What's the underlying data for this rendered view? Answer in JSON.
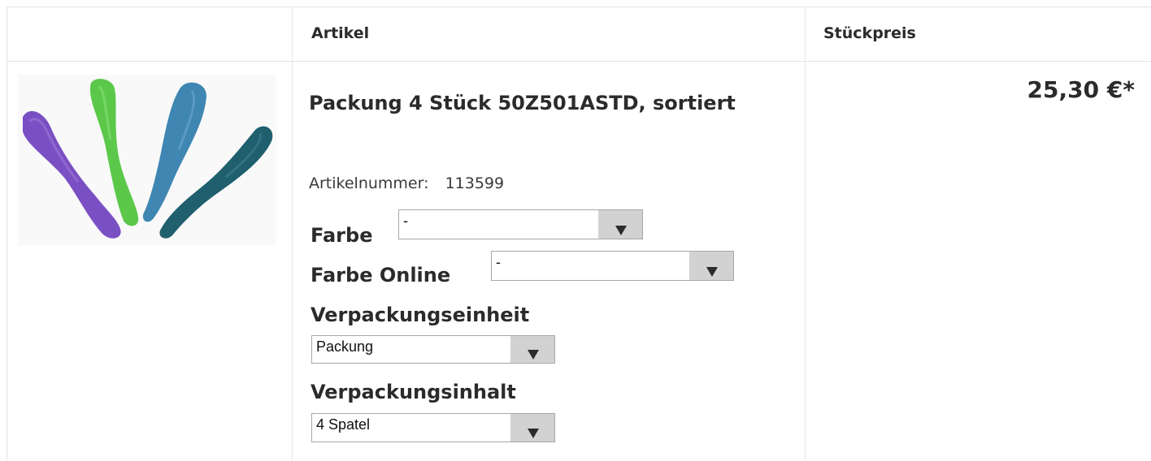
{
  "table": {
    "headers": {
      "article": "Artikel",
      "unit_price": "Stückpreis"
    }
  },
  "product": {
    "image_icon": "spatula-set-image",
    "image_colors": [
      "#7a4fc3",
      "#5bc84a",
      "#3f86b3",
      "#1f5f6e"
    ],
    "title": "Packung 4 Stück 50Z501ASTD, sortiert",
    "article_number_label": "Artikelnummer:",
    "article_number": "113599",
    "price": "25,30 €*",
    "options": {
      "farbe": {
        "label": "Farbe",
        "selected": "-"
      },
      "farbe_online": {
        "label": "Farbe Online",
        "selected": "-"
      },
      "verpackungseinheit": {
        "label": "Verpackungseinheit",
        "selected": "Packung"
      },
      "verpackungsinhalt": {
        "label": "Verpackungsinhalt",
        "selected": "4 Spatel"
      }
    }
  }
}
